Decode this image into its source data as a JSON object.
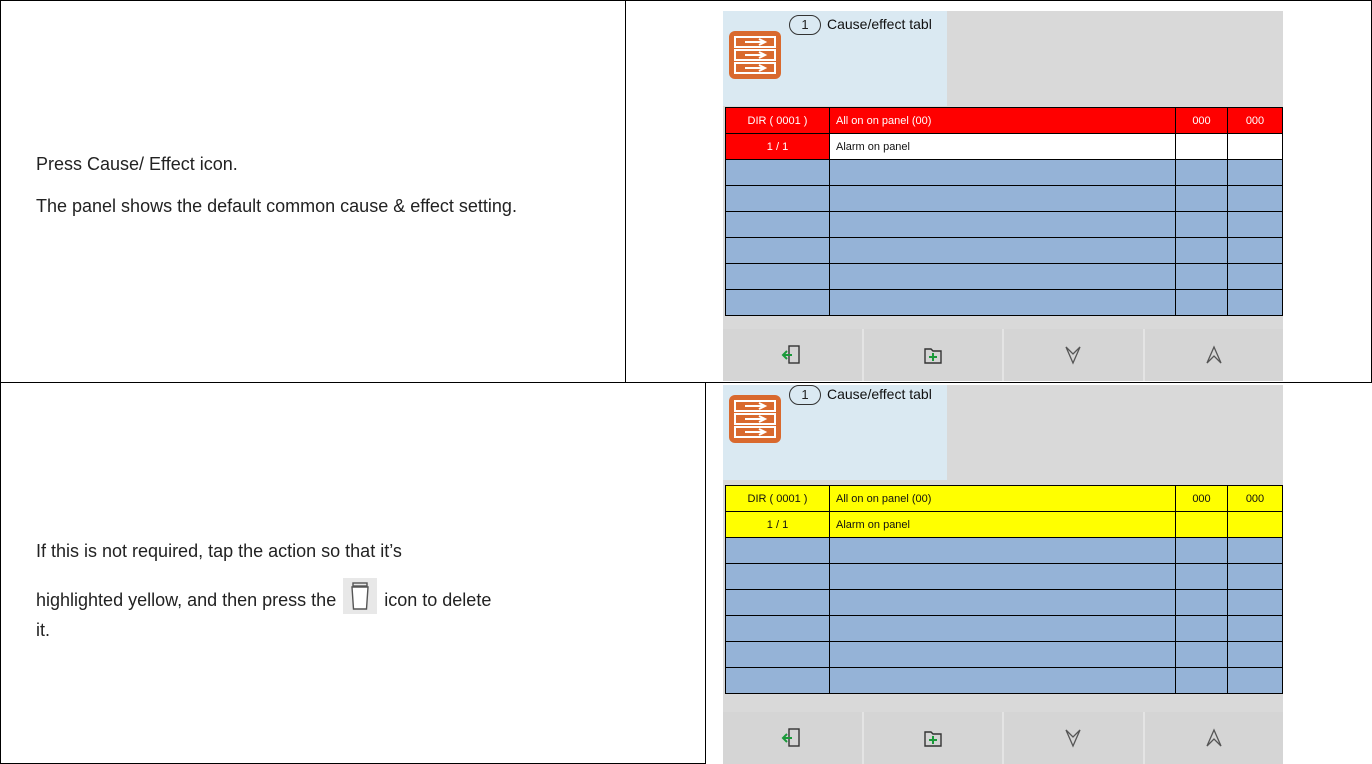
{
  "rows": [
    {
      "instructions": [
        "Press Cause/ Effect icon.",
        "The panel shows the default common cause & effect setting."
      ],
      "panel": {
        "badge": "1",
        "title": "Cause/effect tabl",
        "icon": "cause-effect-icon",
        "row_color": "#ff0000",
        "row_text_color": "#ffffff",
        "header_row": {
          "cause": "DIR ( 0001 )",
          "description": "All on on panel (00)",
          "val1": "000",
          "val2": "000"
        },
        "action_row": {
          "index": "1 / 1",
          "description": "Alarm on panel",
          "val1": "",
          "val2": ""
        },
        "toolbar": [
          "exit-icon",
          "add-folder-icon",
          "arrow-down-icon",
          "arrow-up-icon"
        ]
      }
    },
    {
      "instructions_part1": "If this is not required, tap the action so that it’s",
      "instructions_part2": "highlighted yellow, and then press the",
      "instructions_part3": "icon to delete",
      "instructions_part4": "it.",
      "inline_icon": "trash-icon",
      "panel": {
        "badge": "1",
        "title": "Cause/effect tabl",
        "icon": "cause-effect-icon",
        "row_color": "#ffff00",
        "row_text_color": "#111111",
        "header_row": {
          "cause": "DIR ( 0001 )",
          "description": "All on on panel (00)",
          "val1": "000",
          "val2": "000"
        },
        "action_row": {
          "index": "1 / 1",
          "description": "Alarm on panel",
          "val1": "",
          "val2": ""
        },
        "toolbar": [
          "exit-icon",
          "add-folder-icon",
          "arrow-down-icon",
          "arrow-up-icon"
        ]
      }
    }
  ],
  "colors": {
    "empty_row": "#95b3d7",
    "header_bg": "#dae9f2",
    "icon_orange": "#d9692e"
  }
}
